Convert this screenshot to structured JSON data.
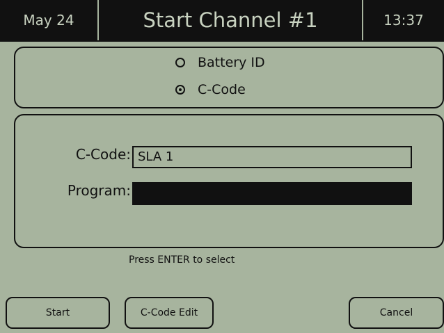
{
  "header": {
    "date": "May 24",
    "title": "Start Channel #1",
    "time": "13:37"
  },
  "selection": {
    "options": [
      {
        "label": "Battery ID",
        "selected": false
      },
      {
        "label": "C-Code",
        "selected": true
      }
    ]
  },
  "form": {
    "ccode_label": "C-Code:",
    "ccode_value": "SLA 1",
    "program_label": "Program:",
    "program_value": ""
  },
  "hint": "Press ENTER to select",
  "buttons": {
    "start": "Start",
    "ccode_edit": "C-Code Edit",
    "cancel": "Cancel"
  }
}
